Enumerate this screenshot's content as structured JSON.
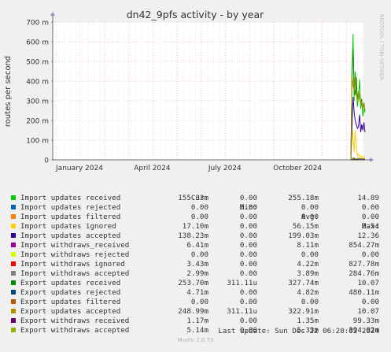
{
  "chart_data": {
    "type": "line",
    "title": "dn42_9pfs activity - by year",
    "ylabel": "routes per second",
    "ylim": [
      0,
      700
    ],
    "yticks": [
      0,
      100,
      200,
      300,
      400,
      500,
      600,
      700
    ],
    "yticklabels": [
      "0",
      "100 m",
      "200 m",
      "300 m",
      "400 m",
      "500 m",
      "600 m",
      "700 m"
    ],
    "xticklabels": [
      "January 2024",
      "April 2024",
      "July 2024",
      "October 2024"
    ],
    "grid": true,
    "side_label": "RRDTOOL / TOBI OETIKER",
    "columns": [
      "Cur:",
      "Min:",
      "Avg:",
      "Max:"
    ],
    "series": [
      {
        "name": "Import updates received",
        "color": "#00cc00",
        "cur": "155.33m",
        "min": "0.00",
        "avg": "255.18m",
        "max": "14.89",
        "values": [
          0,
          420,
          640,
          300,
          450,
          380,
          270,
          320,
          410,
          260,
          300,
          220,
          260,
          240
        ]
      },
      {
        "name": "Import updates rejected",
        "color": "#0066b3",
        "cur": "0.00",
        "min": "0.00",
        "avg": "0.00",
        "max": "0.00",
        "values": [
          0,
          0,
          0,
          0,
          0,
          0,
          0,
          0,
          0,
          0,
          0,
          0,
          0,
          0
        ]
      },
      {
        "name": "Import updates filtered",
        "color": "#ff8000",
        "cur": "0.00",
        "min": "0.00",
        "avg": "0.00",
        "max": "0.00",
        "values": [
          0,
          0,
          0,
          0,
          0,
          0,
          0,
          0,
          0,
          0,
          0,
          0,
          0,
          0
        ]
      },
      {
        "name": "Import updates ignored",
        "color": "#ffcc00",
        "cur": "17.10m",
        "min": "0.00",
        "avg": "56.15m",
        "max": "2.54",
        "values": [
          0,
          160,
          110,
          40,
          150,
          60,
          20,
          30,
          15,
          20,
          12,
          18,
          15,
          17
        ]
      },
      {
        "name": "Import updates accepted",
        "color": "#330099",
        "cur": "138.23m",
        "min": "0.00",
        "avg": "199.03m",
        "max": "12.36",
        "values": [
          0,
          170,
          320,
          240,
          200,
          180,
          160,
          170,
          230,
          140,
          180,
          150,
          190,
          140
        ]
      },
      {
        "name": "Import withdraws_received",
        "color": "#990099",
        "cur": "6.41m",
        "min": "0.00",
        "avg": "8.11m",
        "max": "854.27m",
        "values": [
          0,
          8,
          6,
          10,
          7,
          5,
          6,
          8,
          6,
          7,
          6,
          5,
          6,
          6
        ]
      },
      {
        "name": "Import withdraws rejected",
        "color": "#ccff00",
        "cur": "0.00",
        "min": "0.00",
        "avg": "0.00",
        "max": "0.00",
        "values": [
          0,
          0,
          0,
          0,
          0,
          0,
          0,
          0,
          0,
          0,
          0,
          0,
          0,
          0
        ]
      },
      {
        "name": "Import withdraws ignored",
        "color": "#ff0000",
        "cur": "3.43m",
        "min": "0.00",
        "avg": "4.22m",
        "max": "827.78m",
        "values": [
          0,
          5,
          4,
          6,
          4,
          3,
          4,
          5,
          4,
          4,
          3,
          4,
          3,
          3
        ]
      },
      {
        "name": "Import withdraws accepted",
        "color": "#808080",
        "cur": "2.99m",
        "min": "0.00",
        "avg": "3.89m",
        "max": "284.76m",
        "values": [
          0,
          4,
          3,
          5,
          4,
          3,
          3,
          4,
          3,
          3,
          3,
          3,
          3,
          3
        ]
      },
      {
        "name": "Export updates received",
        "color": "#008f00",
        "cur": "253.70m",
        "min": "311.11u",
        "avg": "327.74m",
        "max": "10.07",
        "values": [
          0,
          440,
          560,
          360,
          330,
          420,
          300,
          350,
          320,
          280,
          310,
          260,
          290,
          250
        ]
      },
      {
        "name": "Export updates rejected",
        "color": "#00487d",
        "cur": "4.71m",
        "min": "0.00",
        "avg": "4.82m",
        "max": "480.11m",
        "values": [
          0,
          6,
          5,
          7,
          5,
          4,
          5,
          6,
          5,
          5,
          4,
          5,
          5,
          5
        ]
      },
      {
        "name": "Export updates filtered",
        "color": "#b35a00",
        "cur": "0.00",
        "min": "0.00",
        "avg": "0.00",
        "max": "0.00",
        "values": [
          0,
          0,
          0,
          0,
          0,
          0,
          0,
          0,
          0,
          0,
          0,
          0,
          0,
          0
        ]
      },
      {
        "name": "Export updates accepted",
        "color": "#b38f00",
        "cur": "248.99m",
        "min": "311.11u",
        "avg": "322.91m",
        "max": "10.07",
        "values": [
          0,
          430,
          380,
          350,
          420,
          330,
          300,
          350,
          310,
          280,
          300,
          260,
          280,
          250
        ]
      },
      {
        "name": "Export withdraws received",
        "color": "#6b006b",
        "cur": "1.17m",
        "min": "0.00",
        "avg": "1.35m",
        "max": "99.33m",
        "values": [
          0,
          2,
          1,
          2,
          1,
          1,
          1,
          2,
          1,
          1,
          1,
          1,
          1,
          1
        ]
      },
      {
        "name": "Export withdraws accepted",
        "color": "#8fb300",
        "cur": "5.14m",
        "min": "0.00",
        "avg": "5.33m",
        "max": "394.02m",
        "values": [
          0,
          7,
          5,
          8,
          6,
          5,
          5,
          6,
          5,
          5,
          5,
          5,
          5,
          5
        ]
      }
    ]
  },
  "last_update": "Last update: Sun Dec 22 06:20:02 2024",
  "footer": "Munin 2.0.73"
}
